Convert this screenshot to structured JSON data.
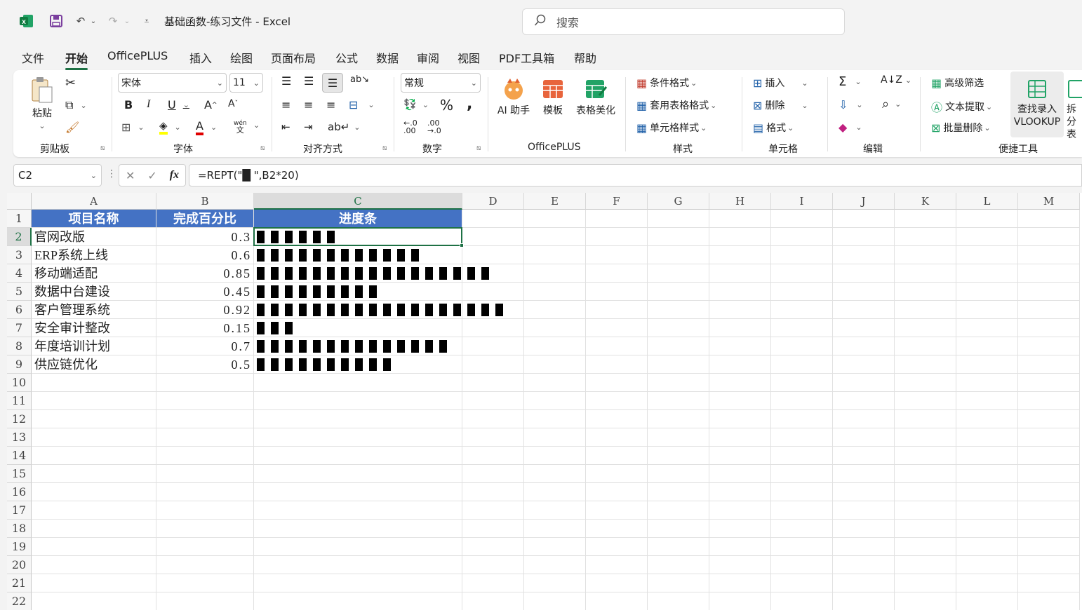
{
  "titlebar": {
    "doc_title": "基础函数-练习文件  -  Excel",
    "search_placeholder": "搜索"
  },
  "tabs": [
    "文件",
    "开始",
    "OfficePLUS",
    "插入",
    "绘图",
    "页面布局",
    "公式",
    "数据",
    "审阅",
    "视图",
    "PDF工具箱",
    "帮助"
  ],
  "active_tab": "开始",
  "ribbon": {
    "clipboard": {
      "paste": "粘贴",
      "label": "剪贴板"
    },
    "font": {
      "name": "宋体",
      "size": "11",
      "label": "字体",
      "phonetic": "wén"
    },
    "alignment": {
      "label": "对齐方式"
    },
    "number": {
      "format": "常规",
      "label": "数字",
      "percent": "%",
      "comma": ","
    },
    "officeplus": {
      "ai": "AI 助手",
      "template": "模板",
      "beautify": "表格美化",
      "label": "OfficePLUS"
    },
    "styles": {
      "conditional": "条件格式",
      "table": "套用表格格式",
      "cell": "单元格样式",
      "label": "样式"
    },
    "cells": {
      "insert": "插入",
      "delete": "删除",
      "format": "格式",
      "label": "单元格"
    },
    "editing": {
      "label": "编辑"
    },
    "quick": {
      "advfilter": "高级筛选",
      "textextract": "文本提取",
      "batchdel": "批量删除",
      "vlookup1": "查找录入",
      "vlookup2": "VLOOKUP",
      "split": "拆分表",
      "label": "便捷工具"
    }
  },
  "formula_bar": {
    "name_box": "C2",
    "fx": "fx",
    "formula": "=REPT(\"█ \",B2*20)"
  },
  "sheet": {
    "columns": [
      "A",
      "B",
      "C",
      "D",
      "E",
      "F",
      "G",
      "H",
      "I",
      "J",
      "K",
      "L",
      "M"
    ],
    "rows": [
      "1",
      "2",
      "3",
      "4",
      "5",
      "6",
      "7",
      "8",
      "9",
      "10",
      "11",
      "12",
      "13",
      "14",
      "15",
      "16",
      "17",
      "18",
      "19",
      "20",
      "21",
      "22"
    ],
    "headers": [
      "项目名称",
      "完成百分比",
      "进度条"
    ],
    "data": [
      {
        "name": "官网改版",
        "pct_text": "0.3",
        "pct": 0.3
      },
      {
        "name": "ERP系统上线",
        "pct_text": "0.6",
        "pct": 0.6
      },
      {
        "name": "移动端适配",
        "pct_text": "0.85",
        "pct": 0.85
      },
      {
        "name": "数据中台建设",
        "pct_text": "0.45",
        "pct": 0.45
      },
      {
        "name": "客户管理系统",
        "pct_text": "0.92",
        "pct": 0.92
      },
      {
        "name": "安全审计整改",
        "pct_text": "0.15",
        "pct": 0.15
      },
      {
        "name": "年度培训计划",
        "pct_text": "0.7",
        "pct": 0.7
      },
      {
        "name": "供应链优化",
        "pct_text": "0.5",
        "pct": 0.5
      }
    ]
  },
  "colors": {
    "accent": "#1e7145",
    "header_fill": "#4472c4"
  }
}
